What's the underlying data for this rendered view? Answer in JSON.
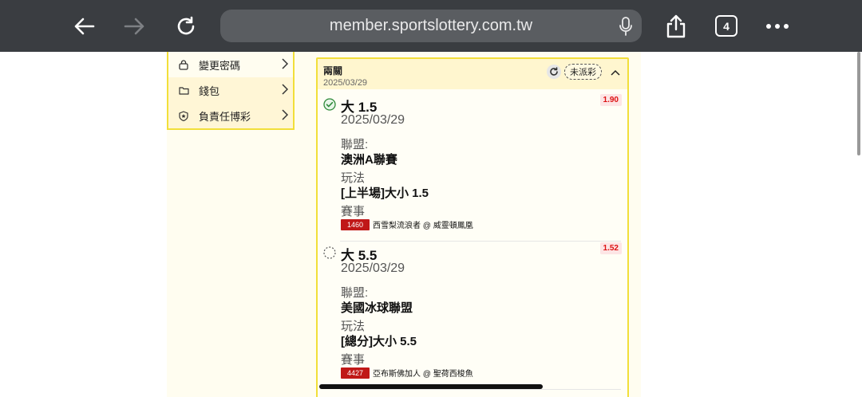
{
  "browser": {
    "url": "member.sportslottery.com.tw",
    "tab_count": "4"
  },
  "menu": {
    "items": [
      {
        "label": "變更密碼",
        "icon": "lock-icon"
      },
      {
        "label": "錢包",
        "icon": "wallet-icon"
      },
      {
        "label": "負責任博彩",
        "icon": "shield-star-icon"
      }
    ]
  },
  "ticket": {
    "title": "兩關",
    "date": "2025/03/29",
    "status": "未派彩",
    "bets": [
      {
        "selection": "大 1.5",
        "date": "2025/03/29",
        "league_label": "聯盟:",
        "league": "澳洲A聯賽",
        "market_label": "玩法",
        "market": "[上半場]大小 1.5",
        "event_label": "賽事",
        "game_no": "1460",
        "teams": "西雪梨流浪者 @ 威靈頓鳳凰",
        "odds": "1.90",
        "status": "settled-check"
      },
      {
        "selection": "大 5.5",
        "date": "2025/03/29",
        "league_label": "聯盟:",
        "league": "美國冰球聯盟",
        "market_label": "玩法",
        "market": "[總分]大小 5.5",
        "event_label": "賽事",
        "game_no": "4427",
        "teams": "亞布斯佛加人 @ 聖荷西梭魚",
        "odds": "1.52",
        "status": "pending"
      }
    ]
  },
  "colors": {
    "accent_yellow": "#f2df3a",
    "odds_red": "#d11111",
    "game_no_red": "#c01818"
  }
}
